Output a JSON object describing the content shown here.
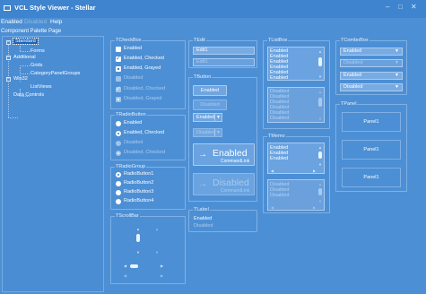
{
  "window": {
    "title": "VCL Style Viewer - Stellar",
    "minimize_glyph": "–",
    "maximize_glyph": "□",
    "close_glyph": "✕"
  },
  "menu": {
    "items": [
      {
        "label": "Enabled",
        "enabled": true
      },
      {
        "label": "Disabled",
        "enabled": false
      },
      {
        "label": "Help",
        "enabled": true
      }
    ]
  },
  "palette_label": "Component Palette Page",
  "tree": {
    "expanded_glyph": "−",
    "items": [
      {
        "label": "Standard",
        "selected": true
      },
      {
        "label": "Forms"
      },
      {
        "label": "Additional"
      },
      {
        "label": "Grids"
      },
      {
        "label": "CategoryPanelGroups"
      },
      {
        "label": "Win32"
      },
      {
        "label": "ListViews"
      },
      {
        "label": "Data Controls"
      }
    ]
  },
  "tcheckbox": {
    "caption": "TCheckBox",
    "check_glyph": "✓",
    "items": [
      {
        "label": "Enabled",
        "checked": false,
        "disabled": false
      },
      {
        "label": "Enabled, Checked",
        "checked": true,
        "disabled": false
      },
      {
        "label": "Enabled, Grayed",
        "checked": false,
        "disabled": false,
        "grayed": true
      },
      {
        "label": "Disabled",
        "checked": false,
        "disabled": true
      },
      {
        "label": "Disabled, Checked",
        "checked": true,
        "disabled": true
      },
      {
        "label": "Disabled, Grayed",
        "checked": false,
        "disabled": true,
        "grayed": true
      }
    ]
  },
  "tradiobutton": {
    "caption": "TRadioButton",
    "items": [
      {
        "label": "Enabled",
        "checked": false,
        "disabled": false
      },
      {
        "label": "Enabled, Checked",
        "checked": true,
        "disabled": false
      },
      {
        "label": "Disabled",
        "checked": false,
        "disabled": true
      },
      {
        "label": "Disabled, Checked",
        "checked": true,
        "disabled": true
      }
    ]
  },
  "tradiogroup": {
    "caption": "TRadioGroup",
    "items": [
      "RadioButton1",
      "RadioButton2",
      "RadioButton3",
      "RadioButton4"
    ],
    "selected_index": 0
  },
  "tscrollbar": {
    "caption": "TScrollBar",
    "up_glyph": "▲",
    "down_glyph": "▼",
    "left_glyph": "◀",
    "right_glyph": "▶"
  },
  "tedit": {
    "caption": "TEdit",
    "enabled_value": "Edit1",
    "disabled_value": "Edit1"
  },
  "tbutton": {
    "caption": "TButton",
    "enabled_label": "Enabled",
    "disabled_label": "Disabled",
    "split_enabled_label": "Enabled",
    "split_disabled_label": "Disabled",
    "split_arrow_glyph": "▼",
    "cmdlink_arrow_glyph": "→",
    "cmdlink_enabled_title": "Enabled",
    "cmdlink_enabled_sub": "CommandLink",
    "cmdlink_disabled_title": "Disabled",
    "cmdlink_disabled_sub": "CommandLink"
  },
  "tlabel": {
    "caption": "TLabel",
    "enabled_text": "Enabled",
    "disabled_text": "Disabled"
  },
  "tlistbox": {
    "caption": "TListBox",
    "up_glyph": "▲",
    "down_glyph": "▼",
    "enabled_items": [
      "Enabled",
      "Enabled",
      "Enabled",
      "Enabled",
      "Enabled",
      "Enabled"
    ],
    "disabled_items": [
      "Disabled",
      "Disabled",
      "Disabled",
      "Disabled",
      "Disabled",
      "Disabled"
    ]
  },
  "tmemo": {
    "caption": "TMemo",
    "enabled_lines": [
      "Enabled",
      "Enabled",
      "Enabled"
    ],
    "disabled_lines": [
      "Disabled",
      "Disabled",
      "Disabled"
    ]
  },
  "tcombobox": {
    "caption": "TComboBox",
    "arrow_glyph": "▼",
    "items": [
      {
        "value": "Enabled",
        "disabled": false
      },
      {
        "value": "Disabled",
        "disabled": true
      },
      {
        "value": "Enabled",
        "disabled": false
      },
      {
        "value": "Disabled",
        "disabled": false
      }
    ]
  },
  "tpanel": {
    "caption": "TPanel",
    "panels": [
      "Panel1",
      "Panel1",
      "Panel1"
    ]
  },
  "colors": {
    "background": "#4d8fd4",
    "titlebar": "#3f84cf",
    "selection": "#1d64b7"
  }
}
